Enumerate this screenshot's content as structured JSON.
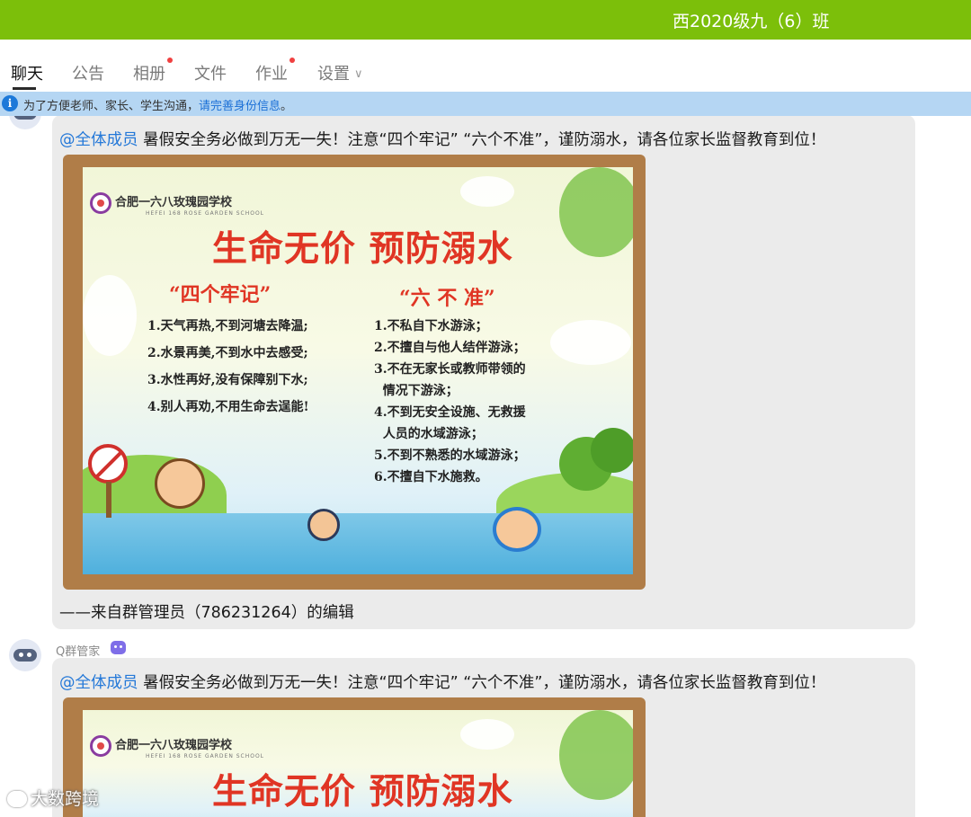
{
  "window": {
    "title": "西2020级九（6）班"
  },
  "tabs": [
    {
      "label": "聊天"
    },
    {
      "label": "公告"
    },
    {
      "label": "相册"
    },
    {
      "label": "文件"
    },
    {
      "label": "作业"
    },
    {
      "label": "设置"
    }
  ],
  "notice": {
    "text": "为了方便老师、家长、学生沟通，",
    "link": "请完善身份信息",
    "suffix": "。"
  },
  "messages": [
    {
      "mention": "@全体成员",
      "text": " 暑假安全务必做到万无一失！注意“四个牢记” “六个不准”，谨防溺水，请各位家长监督教育到位！",
      "footer": "——来自群管理员（786231264）的编辑"
    },
    {
      "sender": "Q群管家",
      "mention": "@全体成员",
      "text": " 暑假安全务必做到万无一失！注意“四个牢记” “六个不准”，谨防溺水，请各位家长监督教育到位！"
    }
  ],
  "poster": {
    "school": "合肥一六八玫瑰园学校",
    "school_en": "HEFEI 168 ROSE GARDEN SCHOOL",
    "title": "生命无价  预防溺水",
    "left_heading": "“四个牢记”",
    "right_heading": "“六 不 准”",
    "left_rules": [
      "1.天气再热,不到河塘去降温;",
      "2.水景再美,不到水中去感受;",
      "3.水性再好,没有保障别下水;",
      "4.别人再劝,不用生命去逞能!"
    ],
    "right_rules": [
      "1.不私自下水游泳；",
      "2.不擅自与他人结伴游泳；",
      "3.不在无家长或教师带领的",
      "  情况下游泳；",
      "4.不到无安全设施、无救援",
      "  人员的水域游泳；",
      "5.不到不熟悉的水域游泳；",
      "6.不擅自下水施救。"
    ]
  },
  "watermark": "大数跨境"
}
